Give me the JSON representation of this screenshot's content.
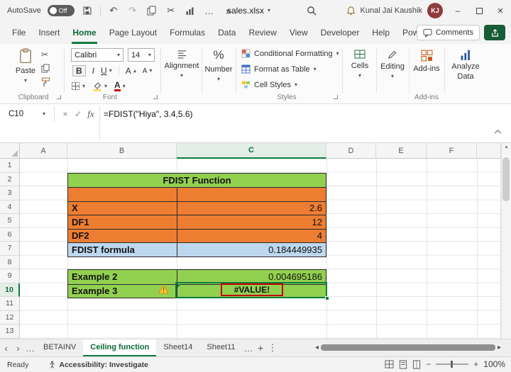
{
  "window": {
    "autosave_label": "AutoSave",
    "autosave_state": "Off",
    "filename": "sales.xlsx",
    "user_name": "Kunal Jai Kaushik",
    "user_initials": "KJ"
  },
  "icons": {
    "caret_down": "▾",
    "undo": "↶",
    "redo": "↷",
    "cut": "✂",
    "more": "…",
    "overflow": "»",
    "ellipsis": "…",
    "plus": "+",
    "kebab": "⋮",
    "chev_left": "‹",
    "chev_right": "›",
    "tri_left": "◂",
    "tri_right": "▸",
    "tri_up": "▴",
    "close": "×",
    "minimize": "–",
    "cancel": "×",
    "enter": "✓",
    "minus": "−",
    "percent": "%"
  },
  "ribbon_tabs": {
    "items": [
      "File",
      "Insert",
      "Home",
      "Page Layout",
      "Formulas",
      "Data",
      "Review",
      "View",
      "Developer",
      "Help",
      "Power Pivot"
    ],
    "active": "Home",
    "comments_label": "Comments"
  },
  "ribbon": {
    "paste_label": "Paste",
    "clipboard_group": "Clipboard",
    "font_name": "Calibri",
    "font_size": "14",
    "bold_label": "B",
    "italic_label": "I",
    "underline_label": "U",
    "font_letter": "A",
    "font_group": "Font",
    "alignment_label": "Alignment",
    "number_label": "Number",
    "conditional_formatting": "Conditional Formatting",
    "format_as_table": "Format as Table",
    "cell_styles": "Cell Styles",
    "styles_group": "Styles",
    "cells_label": "Cells",
    "editing_label": "Editing",
    "addins_label": "Add-ins",
    "addins_group": "Add-ins",
    "analyze_line1": "Analyze",
    "analyze_line2": "Data"
  },
  "formula_bar": {
    "name_box": "C10",
    "fx": "fx",
    "formula": "=FDIST(\"Hiya\", 3.4,5.6)"
  },
  "grid": {
    "columns": [
      "A",
      "B",
      "C",
      "D",
      "E",
      "F"
    ],
    "rows": [
      "1",
      "2",
      "3",
      "4",
      "5",
      "6",
      "7",
      "8",
      "9",
      "10",
      "11",
      "12",
      "13"
    ],
    "selected_column": "C",
    "selected_row": "10"
  },
  "sheet": {
    "title": "FDIST Function",
    "rows": [
      {
        "label": "",
        "value": ""
      },
      {
        "label": "X",
        "value": "2.6"
      },
      {
        "label": "DF1",
        "value": "12"
      },
      {
        "label": "DF2",
        "value": "4"
      },
      {
        "label": "FDIST formula",
        "value": "0.184449935"
      }
    ],
    "examples": [
      {
        "label": "Example 2",
        "value": "0.004695186"
      },
      {
        "label": "Example 3",
        "value": "#VALUE!"
      }
    ]
  },
  "sheet_tabs": {
    "items": [
      "BETAINV",
      "Ceiling function",
      "Sheet14",
      "Sheet11"
    ],
    "active": "Ceiling function"
  },
  "status_bar": {
    "ready": "Ready",
    "accessibility": "Accessibility: Investigate",
    "zoom": "100%"
  },
  "colors": {
    "excel_green": "#107C41",
    "header_fill": "#92D050",
    "orange_fill": "#ED7D31",
    "blue_fill": "#BDD7EE",
    "error_box": "#C00000",
    "avatar": "#8E3B3B"
  }
}
